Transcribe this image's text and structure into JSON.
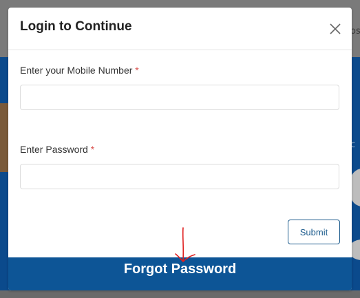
{
  "modal": {
    "title": "Login to Continue",
    "mobile_label": "Enter your Mobile Number",
    "mobile_value": "",
    "password_label": "Enter Password",
    "password_value": "",
    "required_mark": "*",
    "submit_label": "Submit",
    "forgot_label": "Forgot Password"
  },
  "background": {
    "partial_text_top": "os",
    "partial_text_mid": "c"
  },
  "colors": {
    "accent": "#0d5596",
    "required": "#d9534f",
    "annotation_arrow": "#e02020"
  },
  "icons": {
    "close": "close-icon",
    "annotation": "hand-drawn-arrow"
  }
}
